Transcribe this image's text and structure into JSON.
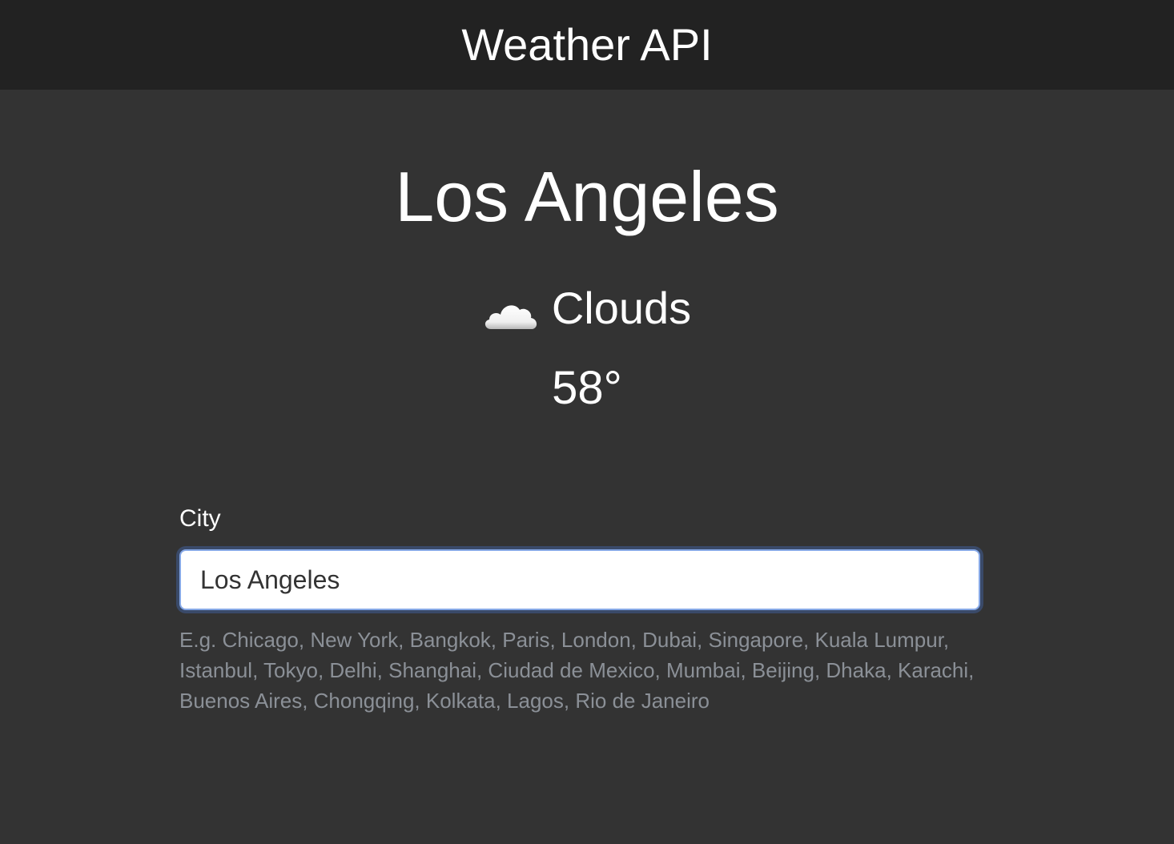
{
  "header": {
    "title": "Weather API"
  },
  "weather": {
    "city": "Los Angeles",
    "condition": "Clouds",
    "condition_icon": "cloud-icon",
    "temperature": "58°"
  },
  "form": {
    "label": "City",
    "input_value": "Los Angeles",
    "hint": "E.g. Chicago, New York, Bangkok, Paris, London, Dubai, Singapore, Kuala Lumpur, Istanbul, Tokyo, Delhi, Shanghai, Ciudad de Mexico, Mumbai, Beijing, Dhaka, Karachi, Buenos Aires, Chongqing, Kolkata, Lagos, Rio de Janeiro"
  },
  "colors": {
    "background": "#333333",
    "header_background": "#222222",
    "input_border": "#86a8e6",
    "hint_text": "#8b9097"
  }
}
